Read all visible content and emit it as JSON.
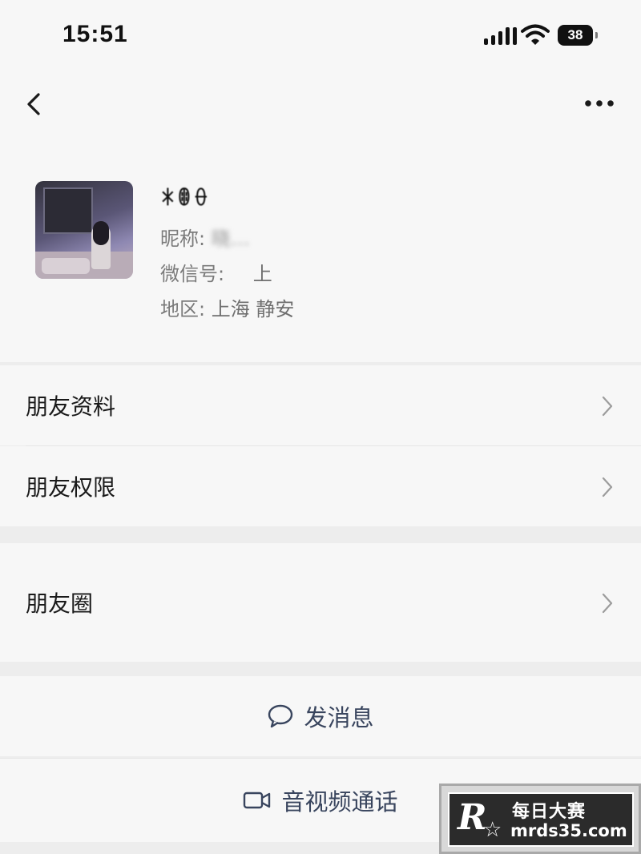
{
  "status_bar": {
    "time": "15:51",
    "battery": "38"
  },
  "profile": {
    "name": "ꁘꂦꂷ",
    "nickname_label": "昵称:",
    "nickname_value": "晓…",
    "wechat_id_label": "微信号:",
    "wechat_id_value": "上",
    "region_label": "地区:",
    "region_value": "上海 静安"
  },
  "menu": {
    "friend_info": "朋友资料",
    "friend_permissions": "朋友权限",
    "moments": "朋友圈"
  },
  "actions": {
    "send_message": "发消息",
    "video_call": "音视频通话"
  },
  "watermark": {
    "logo": "R",
    "star": "☆",
    "title": "每日大赛",
    "url": "mrds35.com"
  },
  "colors": {
    "page_background": "#ededed",
    "card_background": "#f7f7f7",
    "action_text": "#39455e"
  }
}
